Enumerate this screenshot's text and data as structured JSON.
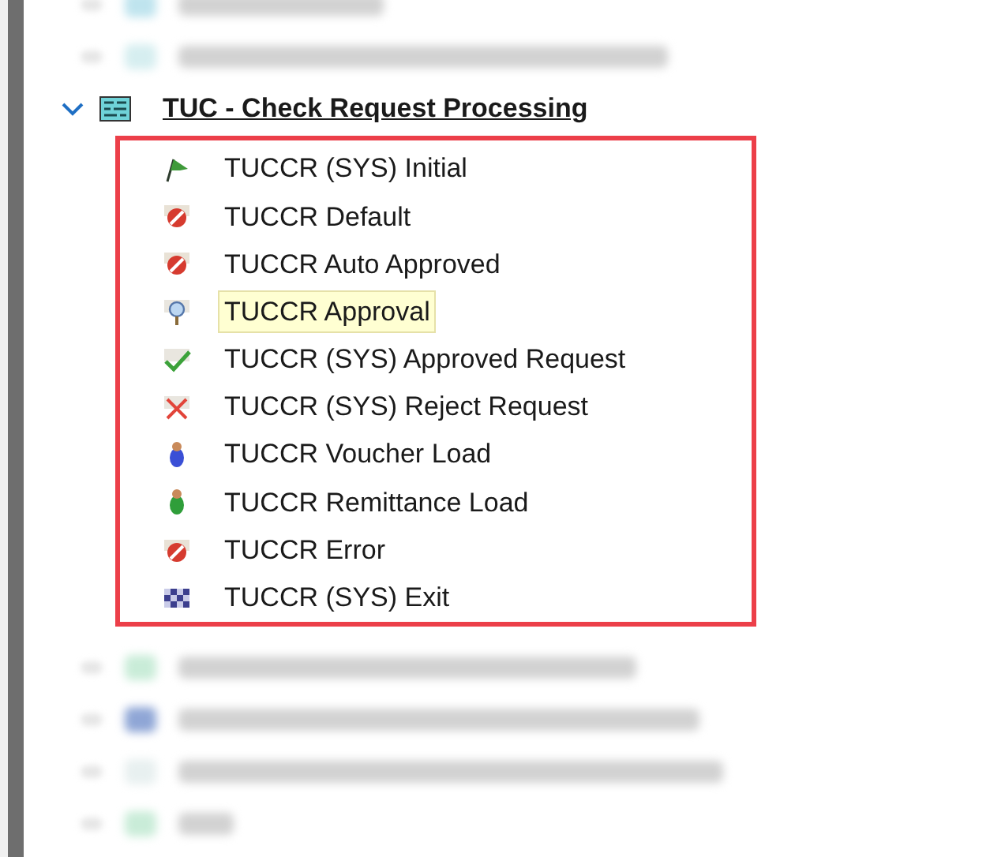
{
  "tree": {
    "group": {
      "title": "TUC - Check Request Processing",
      "expanded": true,
      "children": [
        {
          "label": "TUCCR (SYS) Initial",
          "kind": "flag",
          "selected": false
        },
        {
          "label": "TUCCR Default",
          "kind": "stop",
          "selected": false
        },
        {
          "label": "TUCCR Auto Approved",
          "kind": "stop",
          "selected": false
        },
        {
          "label": "TUCCR Approval",
          "kind": "magnifier",
          "selected": true
        },
        {
          "label": "TUCCR (SYS) Approved Request",
          "kind": "check",
          "selected": false
        },
        {
          "label": "TUCCR (SYS) Reject Request",
          "kind": "cross",
          "selected": false
        },
        {
          "label": "TUCCR Voucher Load",
          "kind": "pawn-blue",
          "selected": false
        },
        {
          "label": "TUCCR Remittance Load",
          "kind": "pawn-green",
          "selected": false
        },
        {
          "label": "TUCCR Error",
          "kind": "stop",
          "selected": false
        },
        {
          "label": "TUCCR (SYS) Exit",
          "kind": "checkered",
          "selected": false
        }
      ]
    }
  }
}
